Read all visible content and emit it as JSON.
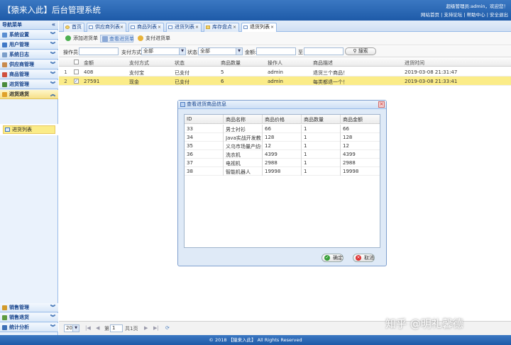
{
  "header": {
    "title": "【猿来入此】后台管理系统",
    "welcome": "超级管理员:admin，欢迎您！",
    "links": [
      "网站首页",
      "支持论坛",
      "帮助中心",
      "安全退出"
    ]
  },
  "sidebar": {
    "title": "导航菜单",
    "menus": [
      {
        "label": "系统设置",
        "color": "#5a8ed1"
      },
      {
        "label": "用户管理",
        "color": "#3f78c6"
      },
      {
        "label": "系统日志",
        "color": "#7b9ec9"
      },
      {
        "label": "供应商管理",
        "color": "#c88a4c"
      },
      {
        "label": "商品管理",
        "color": "#d0503c"
      },
      {
        "label": "进货管理",
        "color": "#4a8b3c"
      },
      {
        "label": "进货退货",
        "color": "#e0a22a"
      }
    ],
    "submenu": "进货列表",
    "bottom_menus": [
      {
        "label": "销售管理",
        "color": "#d29a2a"
      },
      {
        "label": "销售退货",
        "color": "#5d9a3f"
      },
      {
        "label": "统计分析",
        "color": "#3d6fb6"
      }
    ]
  },
  "tabs": [
    "首页",
    "供应商列表",
    "商品列表",
    "进货列表",
    "库存盘点",
    "退货列表"
  ],
  "toolbar": {
    "add": "添加进货单",
    "view": "查看进货单",
    "pay": "支付进货单"
  },
  "search": {
    "operator_label": "操作员:",
    "pay_method_label": "支付方式:",
    "pay_method_value": "全部",
    "status_label": "状态:",
    "status_value": "全部",
    "amount_label": "金额:",
    "to_label": "至",
    "button": "搜索"
  },
  "grid": {
    "headers": [
      "金额",
      "支付方式",
      "状态",
      "商品数量",
      "操作人",
      "商品描述",
      "进货时间"
    ],
    "rows": [
      {
        "rownum": "1",
        "amount": "408",
        "pay": "支付宝",
        "status": "已支付",
        "qty": "5",
        "op": "admin",
        "desc": "退货三个商品！",
        "time": "2019-03-08 21:31:47",
        "selected": false
      },
      {
        "rownum": "2",
        "amount": "27591",
        "pay": "现金",
        "status": "已支付",
        "qty": "6",
        "op": "admin",
        "desc": "每类都退一个！",
        "time": "2019-03-08 21:33:41",
        "selected": true
      }
    ]
  },
  "pager": {
    "page_size": "20",
    "page_label": "第",
    "page_value": "1",
    "total": "共1页"
  },
  "dialog": {
    "title": "查看进货商品信息",
    "headers": [
      "ID",
      "商品名称",
      "商品价格",
      "商品数量",
      "商品金额"
    ],
    "rows": [
      {
        "id": "33",
        "name": "男士衬衫",
        "price": "66",
        "qty": "1",
        "total": "66"
      },
      {
        "id": "34",
        "name": "Java实战开发教程",
        "price": "128",
        "qty": "1",
        "total": "128"
      },
      {
        "id": "35",
        "name": "义乌市场量产纺织",
        "price": "12",
        "qty": "1",
        "total": "12"
      },
      {
        "id": "36",
        "name": "洗衣机",
        "price": "4399",
        "qty": "1",
        "total": "4399"
      },
      {
        "id": "37",
        "name": "电视机",
        "price": "2988",
        "qty": "1",
        "total": "2988"
      },
      {
        "id": "38",
        "name": "智能机器人",
        "price": "19998",
        "qty": "1",
        "total": "19998"
      }
    ],
    "ok": "确定",
    "cancel": "取消"
  },
  "footer": "© 2018 【猿来入此】 All Rights Reserved",
  "watermark": "知乎 @明礼馨德"
}
